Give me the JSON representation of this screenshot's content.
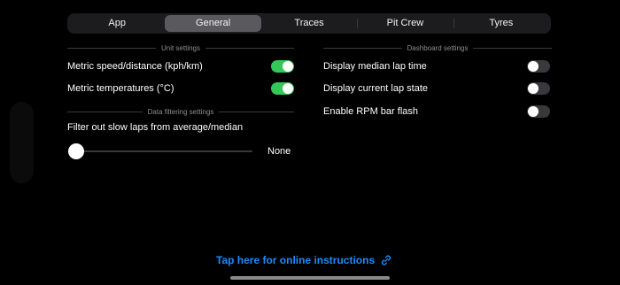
{
  "tabs": [
    {
      "label": "App",
      "selected": false
    },
    {
      "label": "General",
      "selected": true
    },
    {
      "label": "Traces",
      "selected": false
    },
    {
      "label": "Pit Crew",
      "selected": false
    },
    {
      "label": "Tyres",
      "selected": false
    }
  ],
  "unit_settings": {
    "header": "Unit settings",
    "metric_speed": {
      "label": "Metric speed/distance (kph/km)",
      "on": true
    },
    "metric_temp": {
      "label": "Metric temperatures (°C)",
      "on": true
    }
  },
  "data_filtering": {
    "header": "Data filtering settings",
    "filter_label": "Filter out slow laps from average/median",
    "slider_value_text": "None",
    "slider_fraction": 0
  },
  "dashboard_settings": {
    "header": "Dashboard settings",
    "median_lap": {
      "label": "Display median lap time",
      "on": false
    },
    "lap_state": {
      "label": "Display current lap state",
      "on": false
    },
    "rpm_flash": {
      "label": "Enable RPM bar flash",
      "on": false
    }
  },
  "footer": {
    "link_text": "Tap here for online instructions",
    "link_icon": "link-icon"
  },
  "colors": {
    "accent_green": "#34c759",
    "link_blue": "#1a8cff",
    "background": "#000000"
  }
}
